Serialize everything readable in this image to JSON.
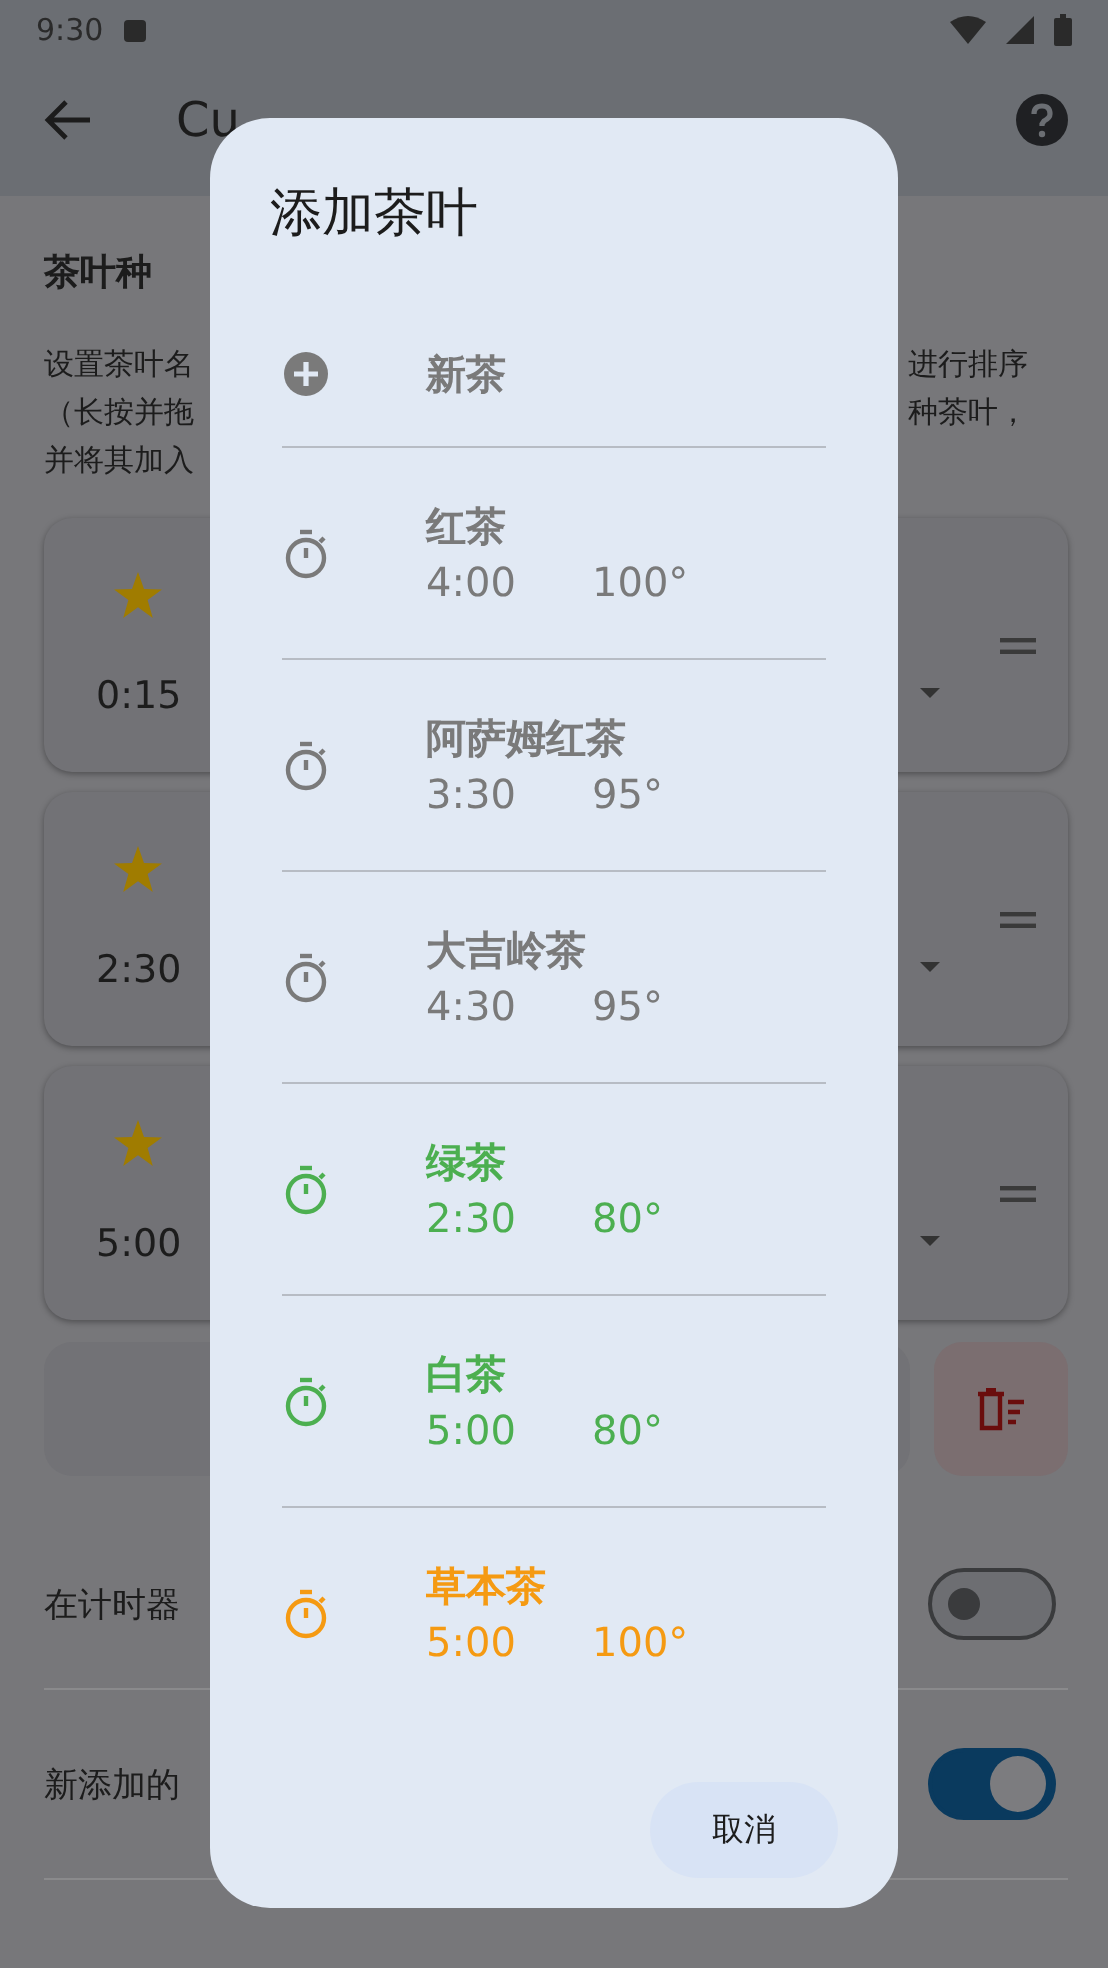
{
  "status_bar": {
    "time": "9:30"
  },
  "app_bar": {
    "title": "Cu"
  },
  "section": {
    "heading": "茶叶种",
    "description_left": [
      "设置茶叶名",
      "（长按并拖",
      "并将其加入"
    ],
    "description_right": [
      "进行排序",
      "种茶叶，"
    ]
  },
  "tea_cards": [
    {
      "starred": true,
      "time": "0:15"
    },
    {
      "starred": true,
      "time": "2:30"
    },
    {
      "starred": true,
      "time": "5:00"
    }
  ],
  "settings": [
    {
      "label": "在计时器",
      "on": false
    },
    {
      "label": "新添加的",
      "on": true
    }
  ],
  "dialog": {
    "title": "添加茶叶",
    "items": [
      {
        "kind": "new",
        "name": "新茶"
      },
      {
        "kind": "tea",
        "name": "红茶",
        "time": "4:00",
        "temperature": "100°",
        "color": "#7a7a7a"
      },
      {
        "kind": "tea",
        "name": "阿萨姆红茶",
        "time": "3:30",
        "temperature": "95°",
        "color": "#7a7a7a"
      },
      {
        "kind": "tea",
        "name": "大吉岭茶",
        "time": "4:30",
        "temperature": "95°",
        "color": "#7a7a7a"
      },
      {
        "kind": "tea",
        "name": "绿茶",
        "time": "2:30",
        "temperature": "80°",
        "color": "#4caf50"
      },
      {
        "kind": "tea",
        "name": "白茶",
        "time": "5:00",
        "temperature": "80°",
        "color": "#4caf50"
      },
      {
        "kind": "tea",
        "name": "草本茶",
        "time": "5:00",
        "temperature": "100°",
        "color": "#f59a12"
      }
    ],
    "cancel": "取消"
  }
}
